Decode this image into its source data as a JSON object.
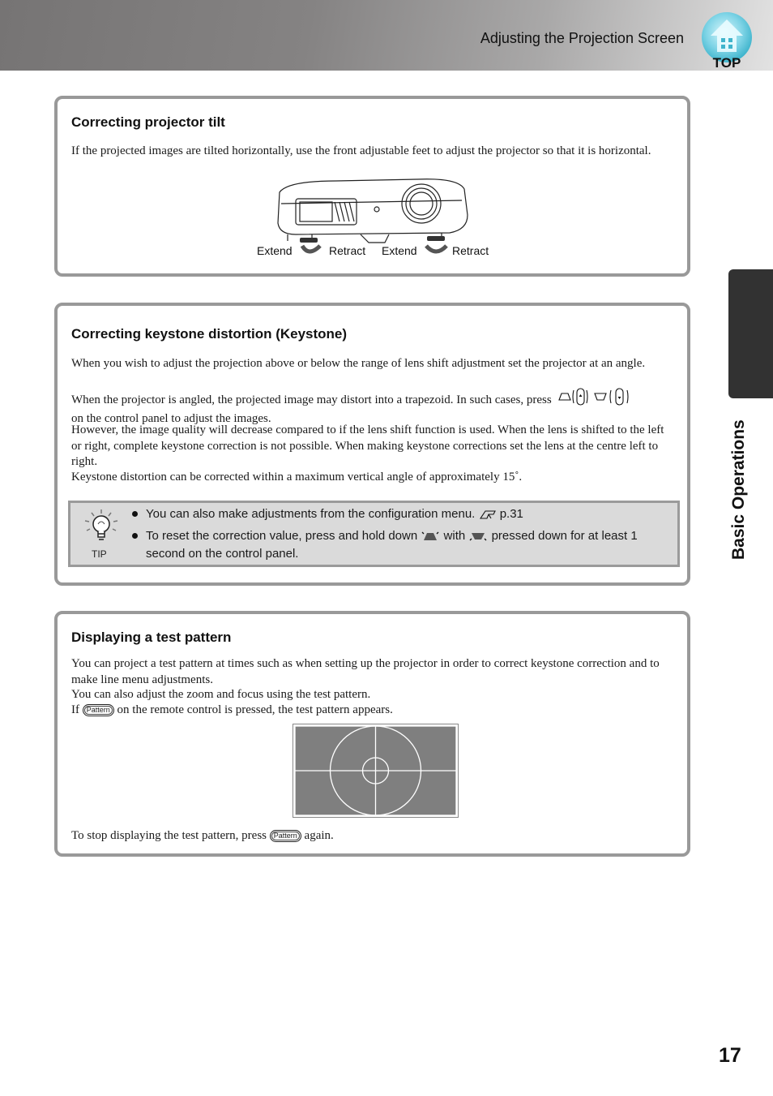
{
  "header": {
    "title": "Adjusting the Projection Screen",
    "top_button_label": "TOP"
  },
  "side_tab": {
    "label": "Basic Operations"
  },
  "page_number": "17",
  "sections": [
    {
      "title": "Correcting projector tilt",
      "paragraphs": [
        "If the projected images are tilted horizontally, use the front adjustable feet to adjust the projector so that it is horizontal."
      ],
      "figure_labels": [
        "Extend",
        "Retract",
        "Extend",
        "Retract"
      ]
    },
    {
      "title": "Correcting keystone distortion (Keystone)",
      "paragraphs": [
        "When you wish to adjust the projection above or below the range of lens shift adjustment set the projector at an angle.",
        "When the projector is angled, the projected image may distort into a trapezoid. In such cases, press",
        "on the control panel to adjust the images.",
        "However, the image quality will decrease compared to if the lens shift function is used. When the lens is shifted to the left or right, complete keystone correction is not possible. When making keystone corrections set the lens at the centre left to right.",
        "Keystone distortion can be corrected within a maximum vertical angle of approximately 15˚."
      ],
      "tip": {
        "label": "TIP",
        "items": [
          {
            "text": "You can also make adjustments from the configuration menu.",
            "ref": "p.31"
          },
          {
            "text_before": "To reset the correction value, press and hold down",
            "text_middle": "with",
            "text_after": "pressed down for at least 1 second on the control panel."
          }
        ]
      }
    },
    {
      "title": "Displaying a test pattern",
      "paragraphs": [
        "You can project a test pattern at times such as when setting up the projector in order to correct keystone correction and to make line menu adjustments.",
        "You can also adjust the zoom and focus using the test pattern.",
        "If",
        "on the remote control is pressed, the test pattern appears.",
        "To stop displaying the test pattern, press",
        "again."
      ],
      "button_label": "Pattern"
    }
  ]
}
